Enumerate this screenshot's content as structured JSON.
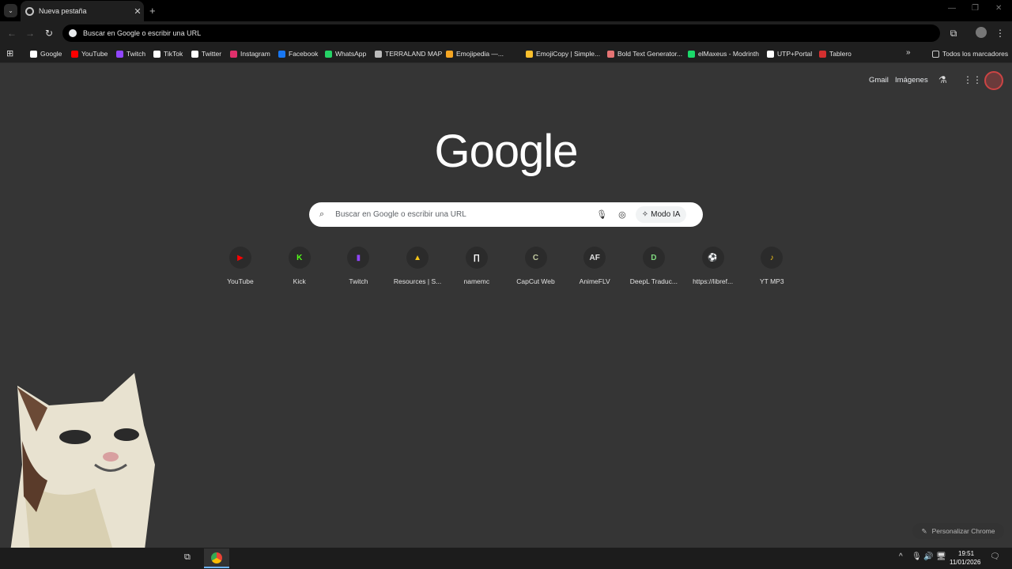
{
  "tab": {
    "title": "Nueva pestaña",
    "close": "✕",
    "new": "+"
  },
  "omnibox": {
    "text": "Buscar en Google o escribir una URL"
  },
  "bookmarks": [
    {
      "label": "Google",
      "color": "#ffffff"
    },
    {
      "label": "YouTube",
      "color": "#ff0000"
    },
    {
      "label": "Twitch",
      "color": "#9146ff"
    },
    {
      "label": "TikTok",
      "color": "#ffffff"
    },
    {
      "label": "Twitter",
      "color": "#ffffff"
    },
    {
      "label": "Instagram",
      "color": "#e1306c"
    },
    {
      "label": "Facebook",
      "color": "#1877f2"
    },
    {
      "label": "WhatsApp",
      "color": "#25d366"
    },
    {
      "label": "TERRALAND MAP",
      "color": "#bbbbbb"
    },
    {
      "label": "Emojipedia —...",
      "color": "#f5a623"
    },
    {
      "label": "EmojiCopy | Simple...",
      "color": "#fbc02d"
    },
    {
      "label": "Bold Text Generator...",
      "color": "#e57373"
    },
    {
      "label": "elMaxeus - Modrinth",
      "color": "#1bd96a"
    },
    {
      "label": "UTP+Portal",
      "color": "#ffffff"
    },
    {
      "label": "Tablero",
      "color": "#d32f2f"
    }
  ],
  "all_bookmarks": "Todos los marcadores",
  "header": {
    "gmail": "Gmail",
    "images": "Imágenes"
  },
  "logo": "Google",
  "search": {
    "placeholder": "Buscar en Google o escribir una URL",
    "ai_mode": "Modo IA"
  },
  "shortcuts": [
    {
      "label": "YouTube",
      "glyph": "▶",
      "color": "#ff0000"
    },
    {
      "label": "Kick",
      "glyph": "K",
      "color": "#53fc18"
    },
    {
      "label": "Twitch",
      "glyph": "▮",
      "color": "#9146ff"
    },
    {
      "label": "Resources | S...",
      "glyph": "▲",
      "color": "#f5c518"
    },
    {
      "label": "namemc",
      "glyph": "∏",
      "color": "#ffffff"
    },
    {
      "label": "CapCut Web",
      "glyph": "C",
      "color": "#c0c8a0"
    },
    {
      "label": "AnimeFLV",
      "glyph": "AF",
      "color": "#e0e0e0"
    },
    {
      "label": "DeepL Traduc...",
      "glyph": "D",
      "color": "#7fd87f"
    },
    {
      "label": "https://libref...",
      "glyph": "⚽",
      "color": "#ffffff"
    },
    {
      "label": "YT MP3",
      "glyph": "♪",
      "color": "#f5c518"
    }
  ],
  "customize": "Personalizar Chrome",
  "clock": {
    "time": "19:51",
    "date": "11/01/2026"
  }
}
